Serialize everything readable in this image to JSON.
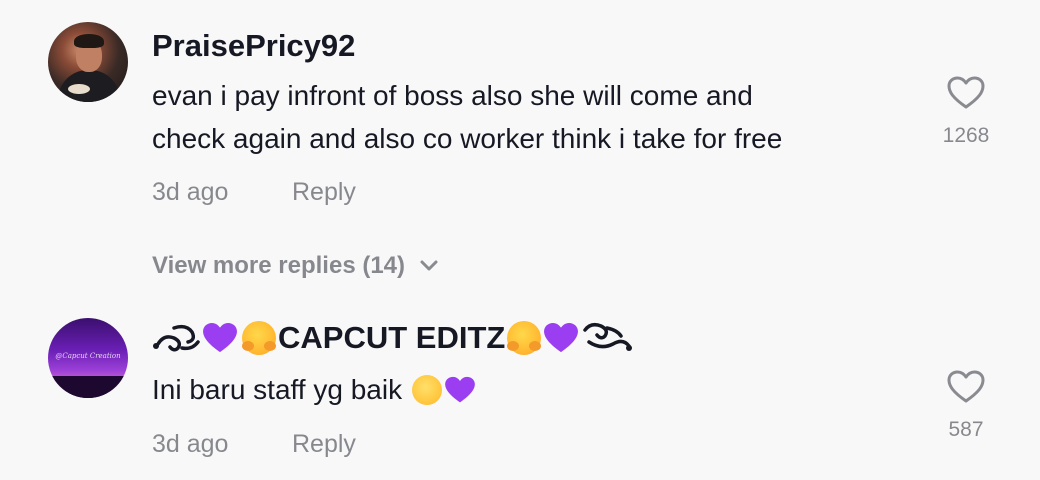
{
  "comments": [
    {
      "username": "PraisePricy92",
      "text_lines": [
        "evan i pay infront of boss also she will come and",
        "check again and also co worker think i take for free"
      ],
      "time": "3d ago",
      "reply_label": "Reply",
      "likes": "1268"
    },
    {
      "username_text": "CAPCUT EDITZ",
      "avatar_watermark": "@Capcut Creation",
      "text": "Ini baru staff yg baik",
      "time": "3d ago",
      "reply_label": "Reply",
      "likes": "587"
    }
  ],
  "view_more": "View more replies (14)",
  "icons": {
    "like": "heart-outline-icon",
    "expand": "chevron-down-icon",
    "emoji_heart": "purple-heart-emoji",
    "emoji_hug": "hugging-face-emoji",
    "emoji_relieved": "relieved-face-emoji"
  },
  "colors": {
    "primary_text": "#161823",
    "secondary_text": "#8a8b91",
    "background": "#f8f8f8",
    "purple_heart": "#9b3df0"
  }
}
